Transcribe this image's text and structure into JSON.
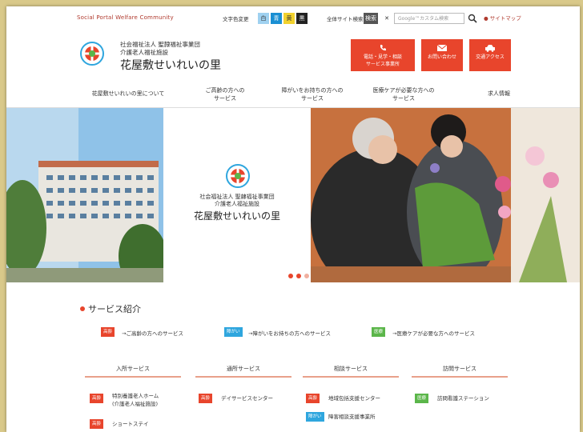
{
  "topbar": {
    "tagline": "Social Portal Welfare Community",
    "font_size_label": "文字色変更",
    "font_size_buttons": [
      {
        "label": "白",
        "bg": "#9fd1f0",
        "fg": "#333"
      },
      {
        "label": "青",
        "bg": "#1a8fd3",
        "fg": "#fff"
      },
      {
        "label": "黄",
        "bg": "#f2d22e",
        "fg": "#333"
      },
      {
        "label": "黒",
        "bg": "#222222",
        "fg": "#fff"
      }
    ],
    "site_search_label": "全体サイト検索",
    "search_button_label": "検索",
    "x_label": "✕",
    "search_placeholder": "Google™カスタム検索",
    "sitemap_label": "● サイトマップ"
  },
  "header": {
    "corp_line1": "社会福祉法人 聖隷福祉事業団",
    "corp_line2": "介護老人福祉施設",
    "site_title": "花屋敷せいれいの里",
    "buttons": [
      {
        "line1": "電話・見学・相談",
        "line2": "サービス事業所",
        "icon": "phone-icon"
      },
      {
        "line1": "お問い合わせ",
        "line2": "",
        "icon": "mail-icon"
      },
      {
        "line1": "交通アクセス",
        "line2": "",
        "icon": "car-icon"
      }
    ]
  },
  "nav": {
    "items": [
      {
        "l1": "花屋敷せいれいの里について",
        "l2": ""
      },
      {
        "l1": "ご高齢の方への",
        "l2": "サービス"
      },
      {
        "l1": "障がいをお持ちの方への",
        "l2": "サービス"
      },
      {
        "l1": "医療ケアが必要な方への",
        "l2": "サービス"
      },
      {
        "l1": "求人情報",
        "l2": ""
      }
    ]
  },
  "hero": {
    "corp_line1": "社会福祉法人 聖隷福祉事業団",
    "corp_line2": "介護老人福祉施設",
    "title": "花屋敷せいれいの里"
  },
  "services": {
    "heading": "サービス紹介",
    "links": [
      {
        "tag": "高齢",
        "tag_color": "#e8452c",
        "text": "→ご高齢の方へのサービス"
      },
      {
        "tag": "障がい",
        "tag_color": "#2fa6de",
        "text": "→障がいをお持ちの方へのサービス"
      },
      {
        "tag": "医療",
        "tag_color": "#5bb64a",
        "text": "→医療ケアが必要な方へのサービス"
      }
    ],
    "columns": [
      {
        "title": "入所サービス",
        "items": [
          {
            "tag": "高齢",
            "tag_color": "#e8452c",
            "l1": "特別養護老人ホーム",
            "l2": "(介護老人福祉施設)"
          },
          {
            "tag": "高齢",
            "tag_color": "#e8452c",
            "l1": "ショートステイ",
            "l2": ""
          }
        ]
      },
      {
        "title": "通所サービス",
        "items": [
          {
            "tag": "高齢",
            "tag_color": "#e8452c",
            "l1": "デイサービスセンター",
            "l2": ""
          }
        ]
      },
      {
        "title": "相談サービス",
        "items": [
          {
            "tag": "高齢",
            "tag_color": "#e8452c",
            "l1": "地域包括支援センター",
            "l2": ""
          },
          {
            "tag": "障がい",
            "tag_color": "#2fa6de",
            "l1": "障害相談支援事業所",
            "l2": ""
          }
        ]
      },
      {
        "title": "訪問サービス",
        "items": [
          {
            "tag": "医療",
            "tag_color": "#5bb64a",
            "l1": "訪問看護ステーション",
            "l2": ""
          }
        ]
      }
    ]
  },
  "colors": {
    "accent": "#e8452c",
    "blue": "#2fa6de",
    "green": "#5bb64a"
  }
}
